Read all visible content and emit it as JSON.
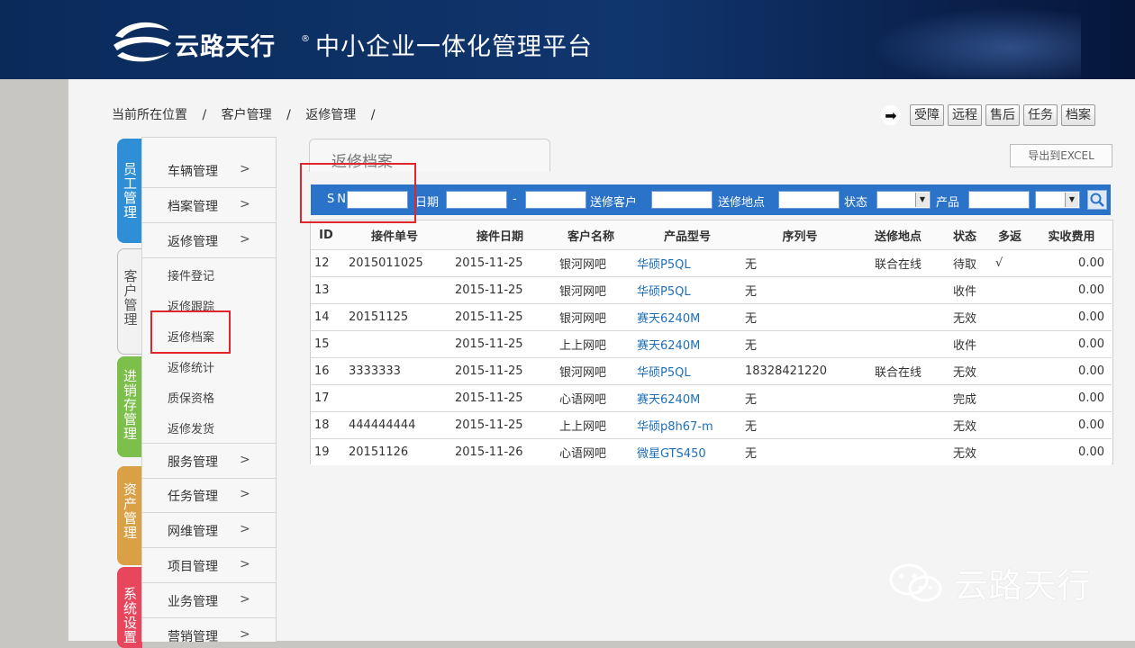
{
  "header": {
    "brand": "云路天行",
    "reg_mark": "®",
    "platform": "中小企业一体化管理平台"
  },
  "breadcrumb": [
    "当前所在位置",
    "客户管理",
    "返修管理"
  ],
  "breadcrumb_sep": "/",
  "quick_buttons": [
    "受障",
    "远程",
    "售后",
    "任务",
    "档案"
  ],
  "vertical_tabs": [
    {
      "label": "员工管理",
      "color": "#2f8fd6"
    },
    {
      "label": "客户管理",
      "color": "#f2f2f2"
    },
    {
      "label": "进销存管理",
      "color": "#7cc04b"
    },
    {
      "label": "资产管理",
      "color": "#d9a046"
    },
    {
      "label": "系统设置",
      "color": "#e8465d"
    }
  ],
  "sidebar": {
    "items_top": [
      {
        "label": "车辆管理",
        "chev": ">"
      },
      {
        "label": "档案管理",
        "chev": ">"
      },
      {
        "label": "返修管理",
        "chev": ">"
      }
    ],
    "sub_items": [
      "接件登记",
      "返修跟踪",
      "返修档案",
      "返修统计",
      "质保资格",
      "返修发货"
    ],
    "items_bottom": [
      {
        "label": "服务管理",
        "chev": ">"
      },
      {
        "label": "任务管理",
        "chev": ">"
      },
      {
        "label": "网维管理",
        "chev": ">"
      },
      {
        "label": "项目管理",
        "chev": ">"
      },
      {
        "label": "业务管理",
        "chev": ">"
      },
      {
        "label": "营销管理",
        "chev": ">"
      }
    ]
  },
  "panel": {
    "tab_title": "返修档案",
    "export_label": "导出到EXCEL"
  },
  "filter": {
    "sn": "SN",
    "date": "日期",
    "dash": "-",
    "customer": "送修客户",
    "location": "送修地点",
    "status": "状态",
    "product": "产品"
  },
  "table": {
    "columns": [
      "ID",
      "接件单号",
      "接件日期",
      "客户名称",
      "产品型号",
      "序列号",
      "送修地点",
      "状态",
      "多返",
      "实收费用"
    ],
    "rows": [
      [
        "12",
        "2015011025",
        "2015-11-25",
        "银河网吧",
        "华硕P5QL",
        "无",
        "联合在线",
        "待取",
        "√",
        "0.00"
      ],
      [
        "13",
        "",
        "2015-11-25",
        "银河网吧",
        "华硕P5QL",
        "无",
        "",
        "收件",
        "",
        "0.00"
      ],
      [
        "14",
        "20151125",
        "2015-11-25",
        "银河网吧",
        "赛天6240M",
        "无",
        "",
        "无效",
        "",
        "0.00"
      ],
      [
        "15",
        "",
        "2015-11-25",
        "上上网吧",
        "赛天6240M",
        "无",
        "",
        "收件",
        "",
        "0.00"
      ],
      [
        "16",
        "3333333",
        "2015-11-25",
        "银河网吧",
        "华硕P5QL",
        "18328421220",
        "联合在线",
        "无效",
        "",
        "0.00"
      ],
      [
        "17",
        "",
        "2015-11-25",
        "心语网吧",
        "赛天6240M",
        "无",
        "",
        "完成",
        "",
        "0.00"
      ],
      [
        "18",
        "444444444",
        "2015-11-25",
        "上上网吧",
        "华硕p8h67-m",
        "无",
        "",
        "无效",
        "",
        "0.00"
      ],
      [
        "19",
        "20151126",
        "2015-11-26",
        "心语网吧",
        "微星GTS450",
        "无",
        "",
        "无效",
        "",
        "0.00"
      ]
    ]
  },
  "watermark": "云路天行",
  "colors": {
    "header_bg": "#10366e",
    "filter_bar": "#2b73c9",
    "link": "#1e6fb8",
    "highlight_box": "#e0262a"
  }
}
